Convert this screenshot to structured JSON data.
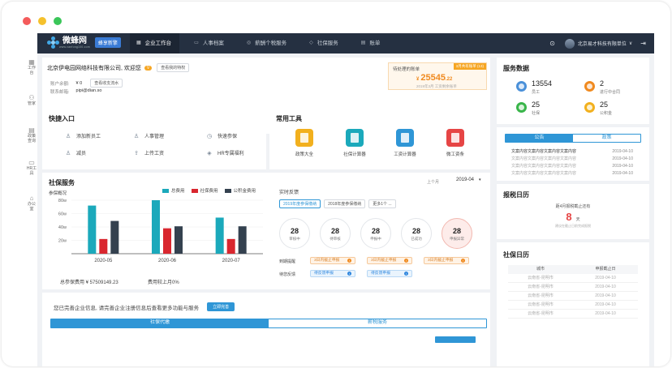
{
  "colors": {
    "topbar": "#253041",
    "accent": "#2f96d6",
    "teal": "#1ba9bb",
    "red": "#d9262e",
    "dark": "#34414f",
    "orange": "#f08a1f"
  },
  "topbar": {
    "logo": "微蜂网",
    "logo_sub": "www.vanfong100.com",
    "badge": "蜂享新擎",
    "nav": [
      {
        "label": "企业工作台",
        "icon": "grid-icon",
        "active": true
      },
      {
        "label": "人事档案",
        "icon": "folder-icon",
        "active": false
      },
      {
        "label": "薪酬个税服务",
        "icon": "wallet-icon",
        "active": false
      },
      {
        "label": "社保服务",
        "icon": "shield-icon",
        "active": false
      },
      {
        "label": "账单",
        "icon": "bill-icon",
        "active": false
      }
    ],
    "company_menu": "北京易才科技有限单位",
    "company_caret": "∨"
  },
  "sidebar": [
    {
      "label": "工作台",
      "icon": "grid-icon"
    },
    {
      "label": "管家",
      "icon": "user-icon"
    },
    {
      "label": "政策查询",
      "icon": "doc-icon"
    },
    {
      "label": "HR工具",
      "icon": "briefcase-icon"
    },
    {
      "label": "办公室",
      "icon": "home-icon"
    }
  ],
  "company": {
    "name": "北京伊电园网络科技有限公司, 欢迎您",
    "badge": "V",
    "view_btn": "查看我的特权",
    "balance_label": "账户余额:",
    "balance_value": "¥ 0",
    "balance_btn": "查看收支流水",
    "email_label": "联系邮箱:",
    "email_value": "pipi@dian.so"
  },
  "bill": {
    "label": "待处理的账单",
    "tag": "3月共有账单 (13)",
    "currency": "¥",
    "amount": "25545",
    "decimal": ".22",
    "note": "2019年3月 工资剩余账单"
  },
  "service_data": {
    "title": "服务数据",
    "items": [
      {
        "value": "13554",
        "label": "员工",
        "color": "#4a90d9"
      },
      {
        "value": "2",
        "label": "进行中合同",
        "color": "#f08a1f"
      },
      {
        "value": "25",
        "label": "社保",
        "color": "#39b54a"
      },
      {
        "value": "25",
        "label": "公积金",
        "color": "#f2b01e"
      }
    ]
  },
  "quick": {
    "title": "快捷入口",
    "items": [
      {
        "label": "添加新员工",
        "icon": "user-plus-icon"
      },
      {
        "label": "人事管理",
        "icon": "users-icon"
      },
      {
        "label": "快速参保",
        "icon": "clock-icon"
      },
      {
        "label": "减员",
        "icon": "user-minus-icon"
      },
      {
        "label": "上传工资",
        "icon": "upload-icon"
      },
      {
        "label": "HR专属福利",
        "icon": "gift-icon"
      }
    ]
  },
  "tools": {
    "title": "常用工具",
    "items": [
      {
        "label": "政策大全",
        "color": "#f2b01e"
      },
      {
        "label": "社保计算器",
        "color": "#1ba9bb"
      },
      {
        "label": "工资计算器",
        "color": "#2f96d6"
      },
      {
        "label": "微工资条",
        "color": "#e64545"
      }
    ]
  },
  "social": {
    "title": "社保服务",
    "prev": "上个月",
    "month": "2019-04",
    "month_caret": "▾",
    "overview": "参保概况",
    "total_label": "总参保费用 ¥ 57509149.23",
    "compare_label": "费用较上月0%",
    "realtime": "实时反馈",
    "filters": [
      "2019年度参保缴纳",
      "2018年度参保缴纳",
      "更多1个 ..."
    ],
    "circles": [
      {
        "value": "28",
        "label": "审核中"
      },
      {
        "value": "28",
        "label": "待审核"
      },
      {
        "value": "28",
        "label": "申报中"
      },
      {
        "value": "28",
        "label": "已成功"
      },
      {
        "value": "28",
        "label": "申报异常"
      }
    ],
    "deadline_label": "到期提醒",
    "deadlines": [
      "3日内截止申报",
      "3日内截止申报",
      "3日内截止申报"
    ],
    "pending_label": "待您反馈",
    "pendings": [
      "待反馈申报",
      "待反馈申报"
    ]
  },
  "chart_data": {
    "type": "bar",
    "categories": [
      "2020-05",
      "2020-06",
      "2020-07"
    ],
    "series": [
      {
        "name": "总费用",
        "values": [
          72,
          80,
          54
        ]
      },
      {
        "name": "社保费用",
        "values": [
          22,
          38,
          22
        ]
      },
      {
        "name": "公积金费用",
        "values": [
          49,
          41,
          41
        ]
      }
    ],
    "ylim": [
      0,
      80
    ],
    "yticks": [
      "80w",
      "60w",
      "40w",
      "20w"
    ],
    "grid": true,
    "legend": "top-right"
  },
  "notice": {
    "text": "您已完善企业信息, 请完善企业注册信息后查看更多功能与服务",
    "btn": "立即完善",
    "tabs": [
      "社保代缴",
      "薪税服务"
    ]
  },
  "announce": {
    "tabs": [
      "公告",
      "政策"
    ],
    "items": [
      {
        "text": "文案内容文案内容文案内容文案内容",
        "date": "2019-04-10",
        "active": true
      },
      {
        "text": "文案内容文案内容文案内容文案内容",
        "date": "2019-04-10",
        "active": false
      },
      {
        "text": "文案内容文案内容文案内容文案内容",
        "date": "2019-04-10",
        "active": false
      },
      {
        "text": "文案内容文案内容文案内容文案内容",
        "date": "2019-04-10",
        "active": false
      }
    ]
  },
  "tax_calendar": {
    "title": "报税日历",
    "desc": "距4月报税截止还有",
    "days": "8",
    "unit": "天",
    "note": "建议在截止日前完成报税"
  },
  "social_calendar": {
    "title": "社保日历",
    "headers": [
      "城市",
      "申报截止日"
    ],
    "rows": [
      [
        "云南省-昆明市",
        "2019-04-10"
      ],
      [
        "云南省-昆明市",
        "2019-04-10"
      ],
      [
        "云南省-昆明市",
        "2019-04-10"
      ],
      [
        "云南省-昆明市",
        "2019-04-10"
      ],
      [
        "云南省-昆明市",
        "2019-04-10"
      ]
    ]
  }
}
